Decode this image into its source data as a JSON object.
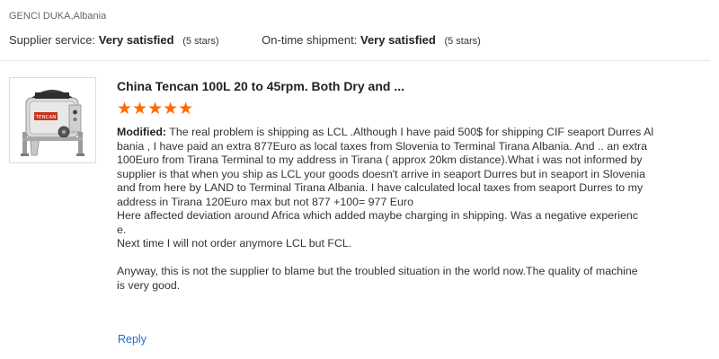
{
  "reviewer": {
    "name": "GENCI DUKA,Albania"
  },
  "ratings": {
    "supplier_service": {
      "label": "Supplier service:",
      "value": "Very satisfied",
      "stars_text": "(5 stars)"
    },
    "on_time_shipment": {
      "label": "On-time shipment:",
      "value": "Very satisfied",
      "stars_text": "(5 stars)"
    }
  },
  "product": {
    "title": "China Tencan 100L 20 to 45rpm. Both Dry and ...",
    "image_logo_text": "TENCAN",
    "star_rating": 5,
    "stars_glyphs": "★★★★★"
  },
  "review": {
    "modified_label": "Modified:",
    "lines": [
      " The real problem is shipping as LCL .Although I have paid 500$ for shipping CIF seaport Durres Al",
      "bania , I have paid an extra 877Euro as local taxes from Slovenia to Terminal Tirana Albania. And .. an extra",
      "100Euro from Tirana Terminal to my address in Tirana ( approx 20km distance).What i was not informed by",
      "supplier is that when you ship as LCL your goods doesn't arrive in seaport Durres but in seaport in Slovenia",
      "and from here by LAND to Terminal  Tirana Albania. I have calculated local taxes from seaport Durres to my",
      "address in Tirana 120Euro max but not 877 +100= 977 Euro",
      "Here affected deviation around Africa which added maybe charging in shipping. Was a negative experienc",
      "e.",
      "Next time I will not order anymore LCL but FCL.",
      "",
      "Anyway, this is not the supplier to blame but the troubled situation in the world now.The quality of machine",
      "is very good."
    ]
  },
  "actions": {
    "reply_label": "Reply"
  },
  "colors": {
    "star": "#ff6a00",
    "link": "#1a6ec6",
    "divider": "#e6e6e6"
  }
}
